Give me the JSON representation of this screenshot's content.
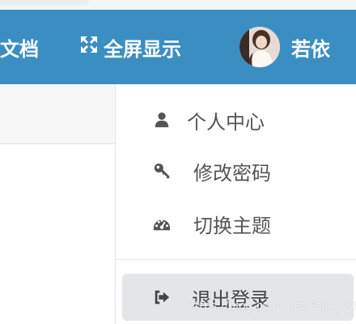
{
  "header": {
    "doc_label": "文档",
    "fullscreen_label": "全屏显示",
    "username": "若依"
  },
  "dropdown": {
    "items": [
      {
        "label": "个人中心",
        "icon": "user-icon"
      },
      {
        "label": "修改密码",
        "icon": "key-icon"
      },
      {
        "label": "切换主题",
        "icon": "dashboard-icon"
      },
      {
        "label": "退出登录",
        "icon": "sign-out-icon"
      }
    ]
  },
  "watermark": "https://blog.csdn.net/Felix_hyfy",
  "colors": {
    "header_bg": "#3b8ec1",
    "menu_text": "#555555",
    "hover_bg": "#e3e5e8"
  }
}
